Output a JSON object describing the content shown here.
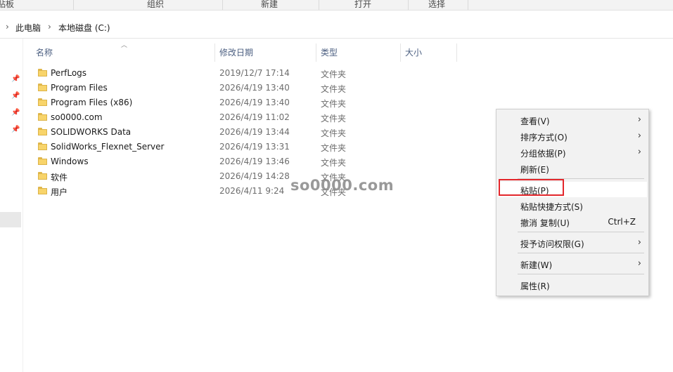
{
  "ribbon": {
    "groups": [
      "贴板",
      "组织",
      "新建",
      "打开",
      "选择"
    ]
  },
  "address": {
    "crumbs": [
      "此电脑",
      "本地磁盘 (C:)"
    ]
  },
  "columns": {
    "name": "名称",
    "date": "修改日期",
    "type": "类型",
    "size": "大小"
  },
  "files": [
    {
      "name": "PerfLogs",
      "date": "2019/12/7 17:14",
      "type": "文件夹"
    },
    {
      "name": "Program Files",
      "date": "2026/4/19 13:40",
      "type": "文件夹"
    },
    {
      "name": "Program Files (x86)",
      "date": "2026/4/19 13:40",
      "type": "文件夹"
    },
    {
      "name": "so0000.com",
      "date": "2026/4/19 11:02",
      "type": "文件夹"
    },
    {
      "name": "SOLIDWORKS Data",
      "date": "2026/4/19 13:44",
      "type": "文件夹"
    },
    {
      "name": "SolidWorks_Flexnet_Server",
      "date": "2026/4/19 13:31",
      "type": "文件夹"
    },
    {
      "name": "Windows",
      "date": "2026/4/19 13:46",
      "type": "文件夹"
    },
    {
      "name": "软件",
      "date": "2026/4/19 14:28",
      "type": "文件夹"
    },
    {
      "name": "用户",
      "date": "2026/4/11 9:24",
      "type": "文件夹"
    }
  ],
  "watermark": "so0000.com",
  "context_menu": {
    "items": [
      {
        "label": "查看(V)",
        "submenu": true
      },
      {
        "label": "排序方式(O)",
        "submenu": true
      },
      {
        "label": "分组依据(P)",
        "submenu": true
      },
      {
        "label": "刷新(E)"
      },
      {
        "label": "粘贴(P)"
      },
      {
        "label": "粘贴快捷方式(S)"
      },
      {
        "label": "撤消 复制(U)",
        "shortcut": "Ctrl+Z"
      },
      {
        "label": "授予访问权限(G)",
        "submenu": true
      },
      {
        "label": "新建(W)",
        "submenu": true
      },
      {
        "label": "属性(R)"
      }
    ]
  },
  "colors": {
    "folder": "#f8d46a",
    "highlight": "#e3262b",
    "header_text": "#4d6082"
  }
}
